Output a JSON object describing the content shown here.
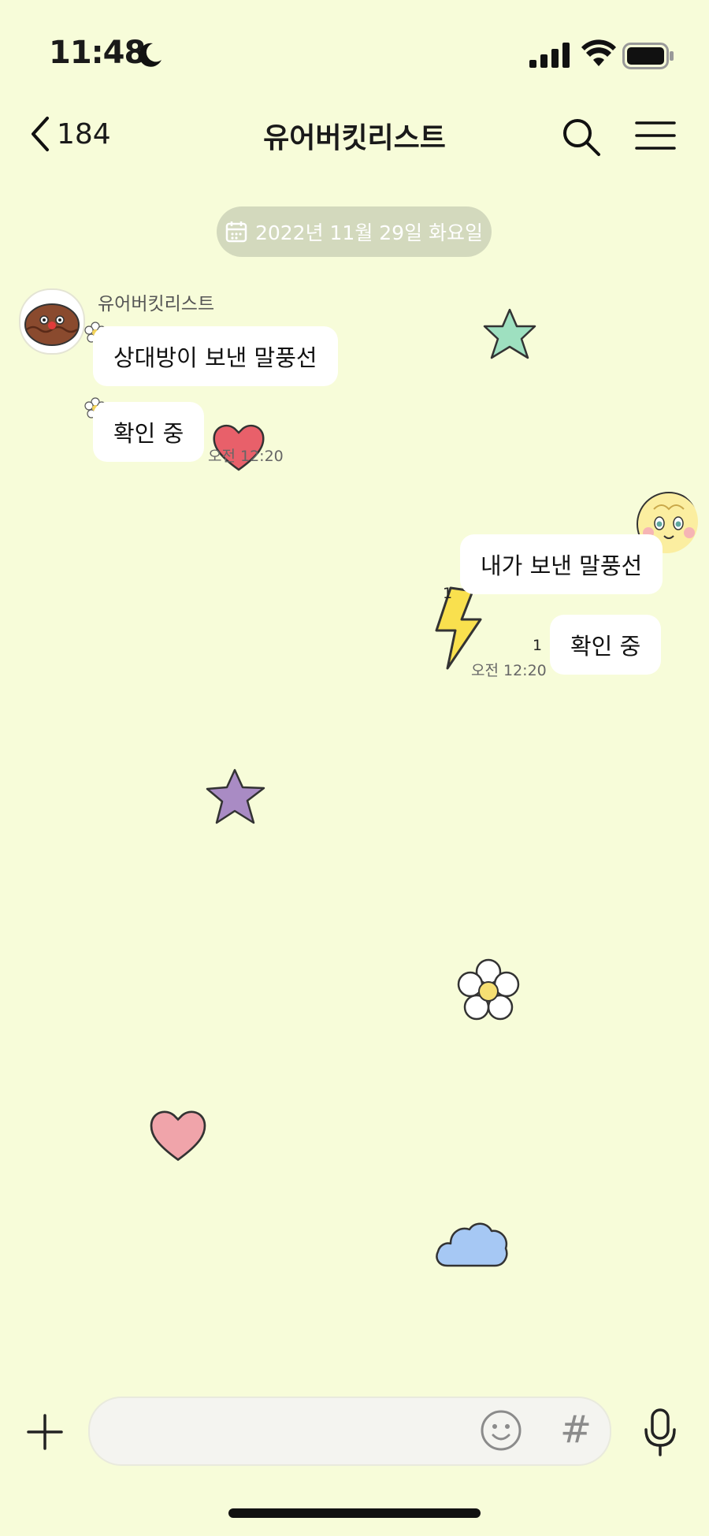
{
  "status_bar": {
    "time": "11:48"
  },
  "header": {
    "back_count": "184",
    "title": "유어버킷리스트"
  },
  "date_divider": "2022년 11월 29일 화요일",
  "incoming": {
    "sender": "유어버킷리스트",
    "messages": [
      "상대방이 보낸 말풍선",
      "확인 중"
    ],
    "time": "오전 12:20"
  },
  "outgoing": {
    "messages": [
      "내가 보낸 말풍선",
      "확인 중"
    ],
    "unread": [
      "1",
      "1"
    ],
    "time": "오전 12:20"
  },
  "input": {
    "placeholder": "",
    "hash_label": "#"
  },
  "colors": {
    "background": "#f7fcd9",
    "date_pill": "#d3d9bd",
    "bubble": "#ffffff",
    "star_green": "#9ee0c0",
    "star_purple": "#a98bc4",
    "heart_red": "#e8606a",
    "heart_pink": "#f0a4aa",
    "bolt_yellow": "#f9e04e",
    "cloud_blue": "#a6c8f4"
  }
}
